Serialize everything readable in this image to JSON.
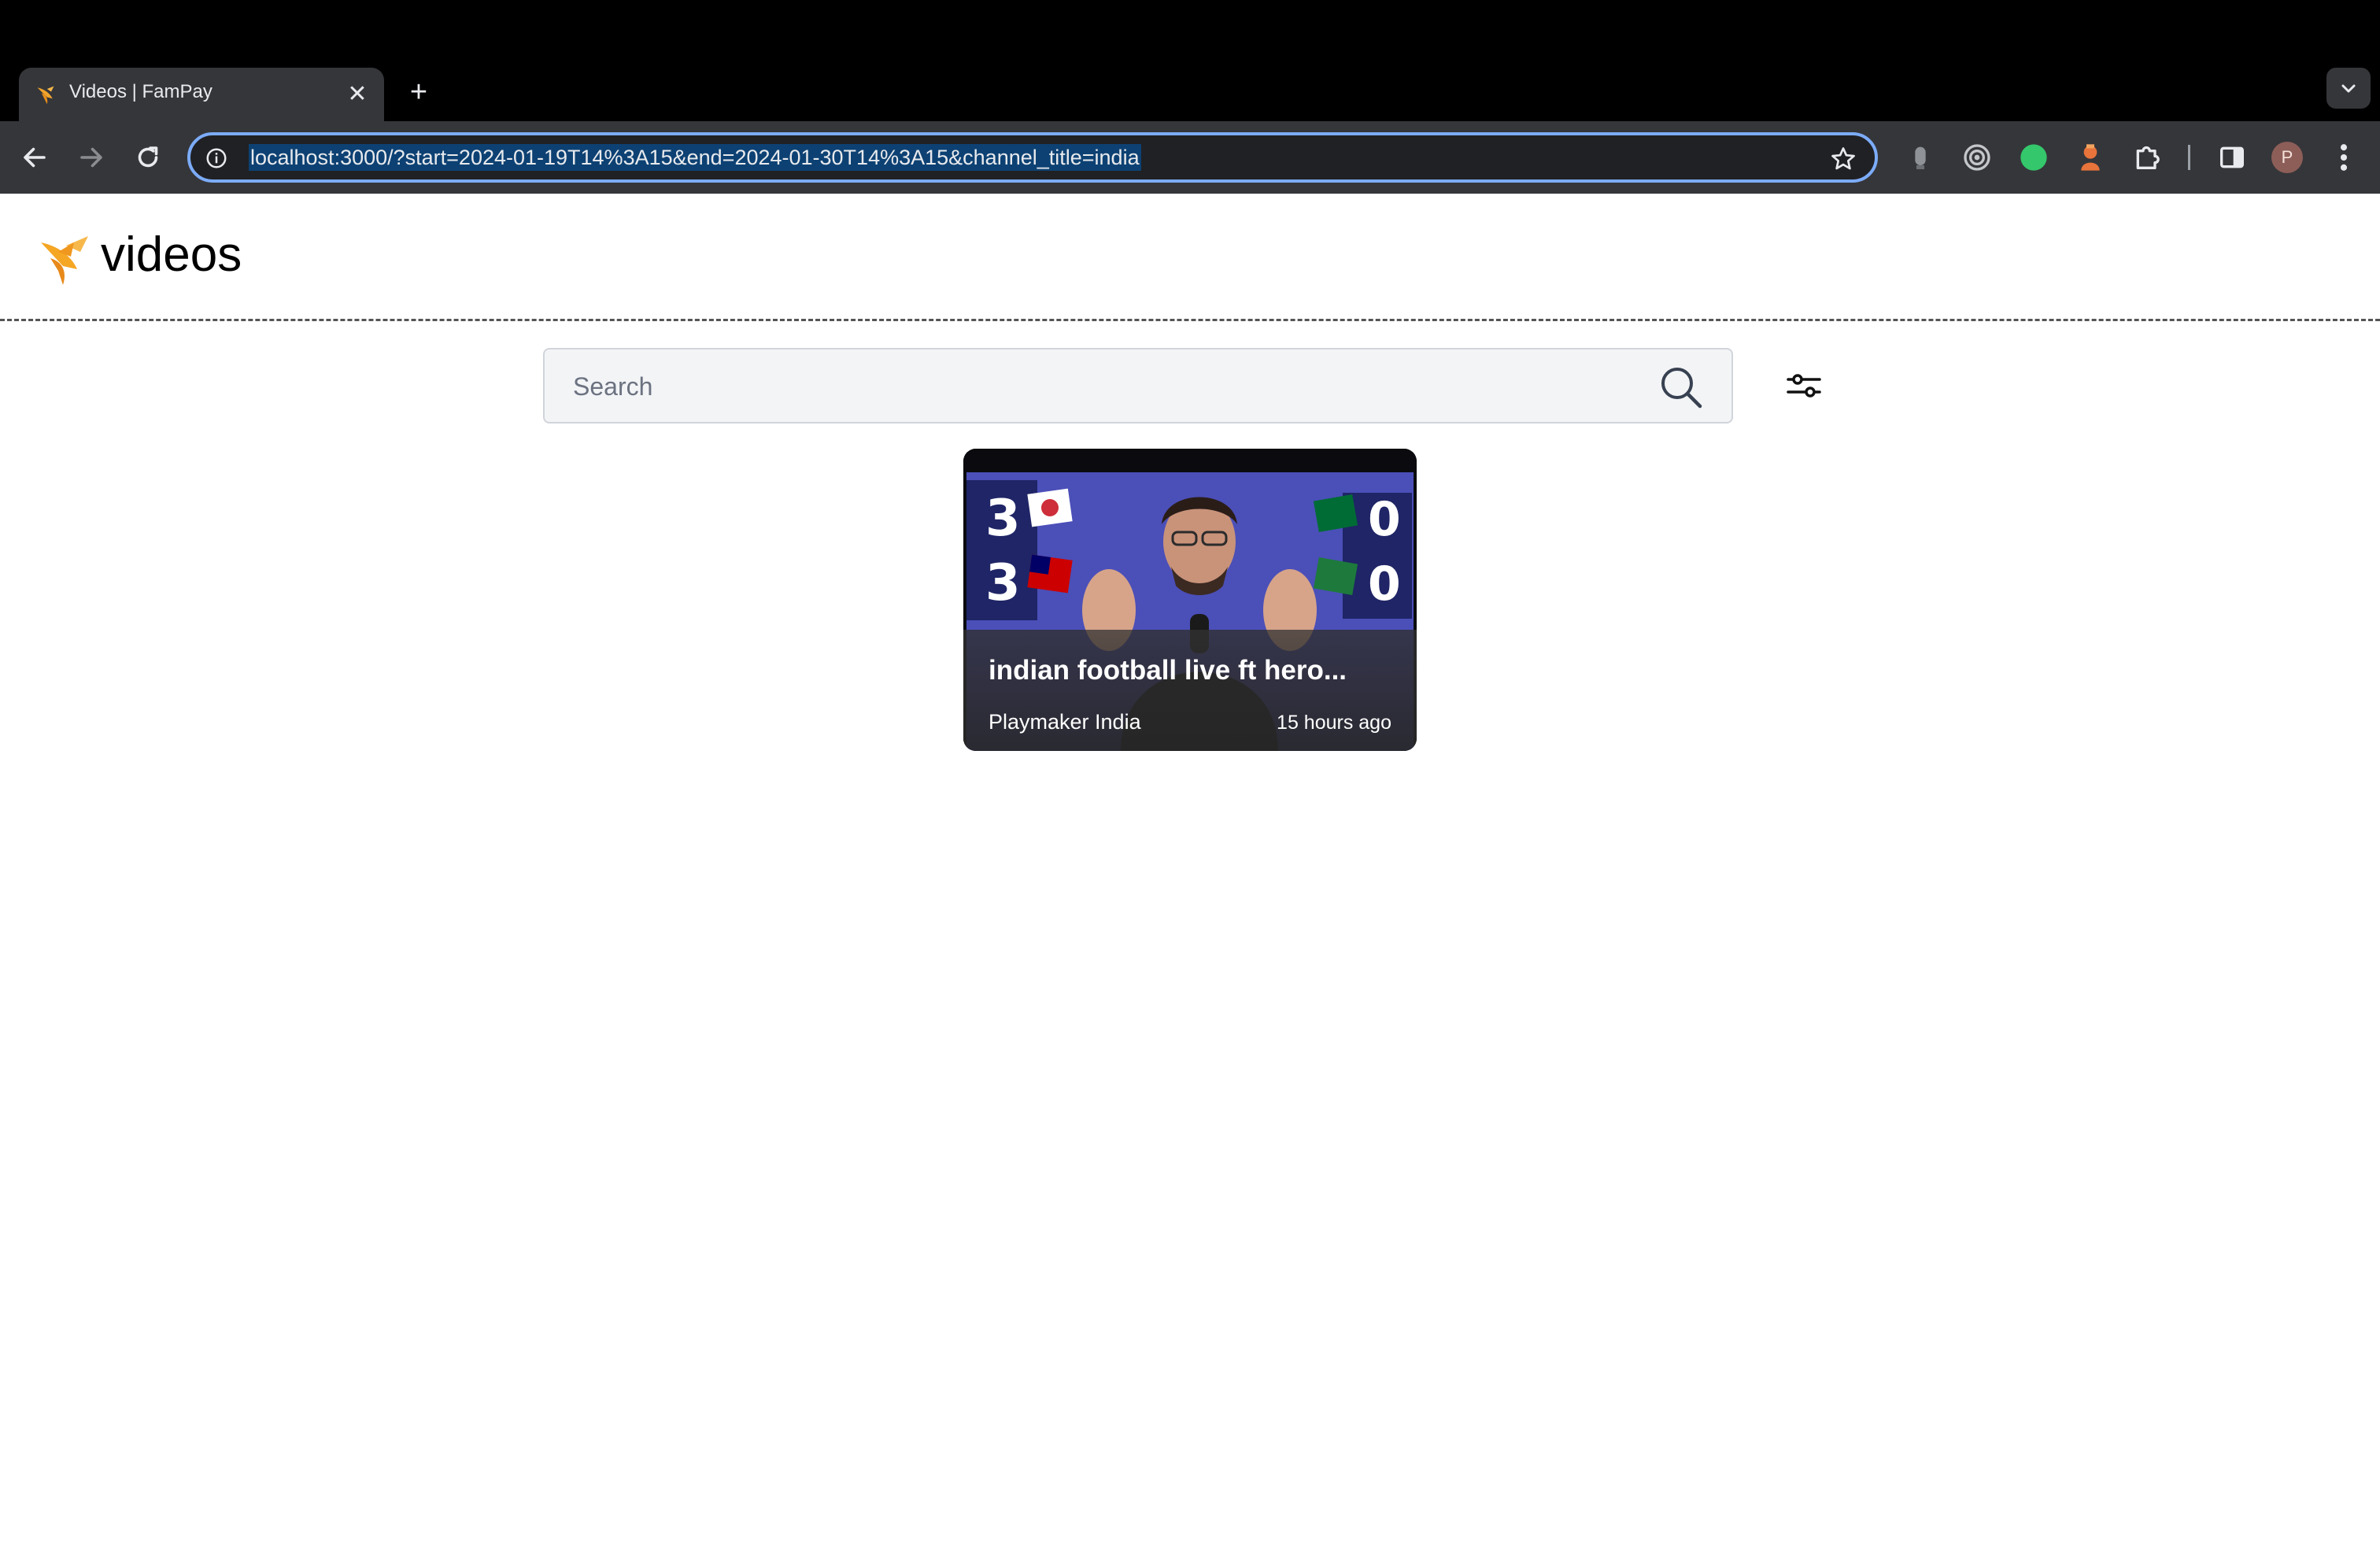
{
  "browser": {
    "tab_title": "Videos | FamPay",
    "url": "localhost:3000/?start=2024-01-19T14%3A15&end=2024-01-30T14%3A15&channel_title=india",
    "profile_initial": "P",
    "accent_color": "#7cacf8"
  },
  "header": {
    "title": "videos",
    "logo_icon": "fampay-bird-logo"
  },
  "search": {
    "placeholder": "Search",
    "value": ""
  },
  "videos": [
    {
      "title": "indian football live ft hero...",
      "channel": "Playmaker India",
      "published": "15 hours ago",
      "thumbnail_scores": [
        "3",
        "3",
        "0",
        "0"
      ]
    }
  ]
}
